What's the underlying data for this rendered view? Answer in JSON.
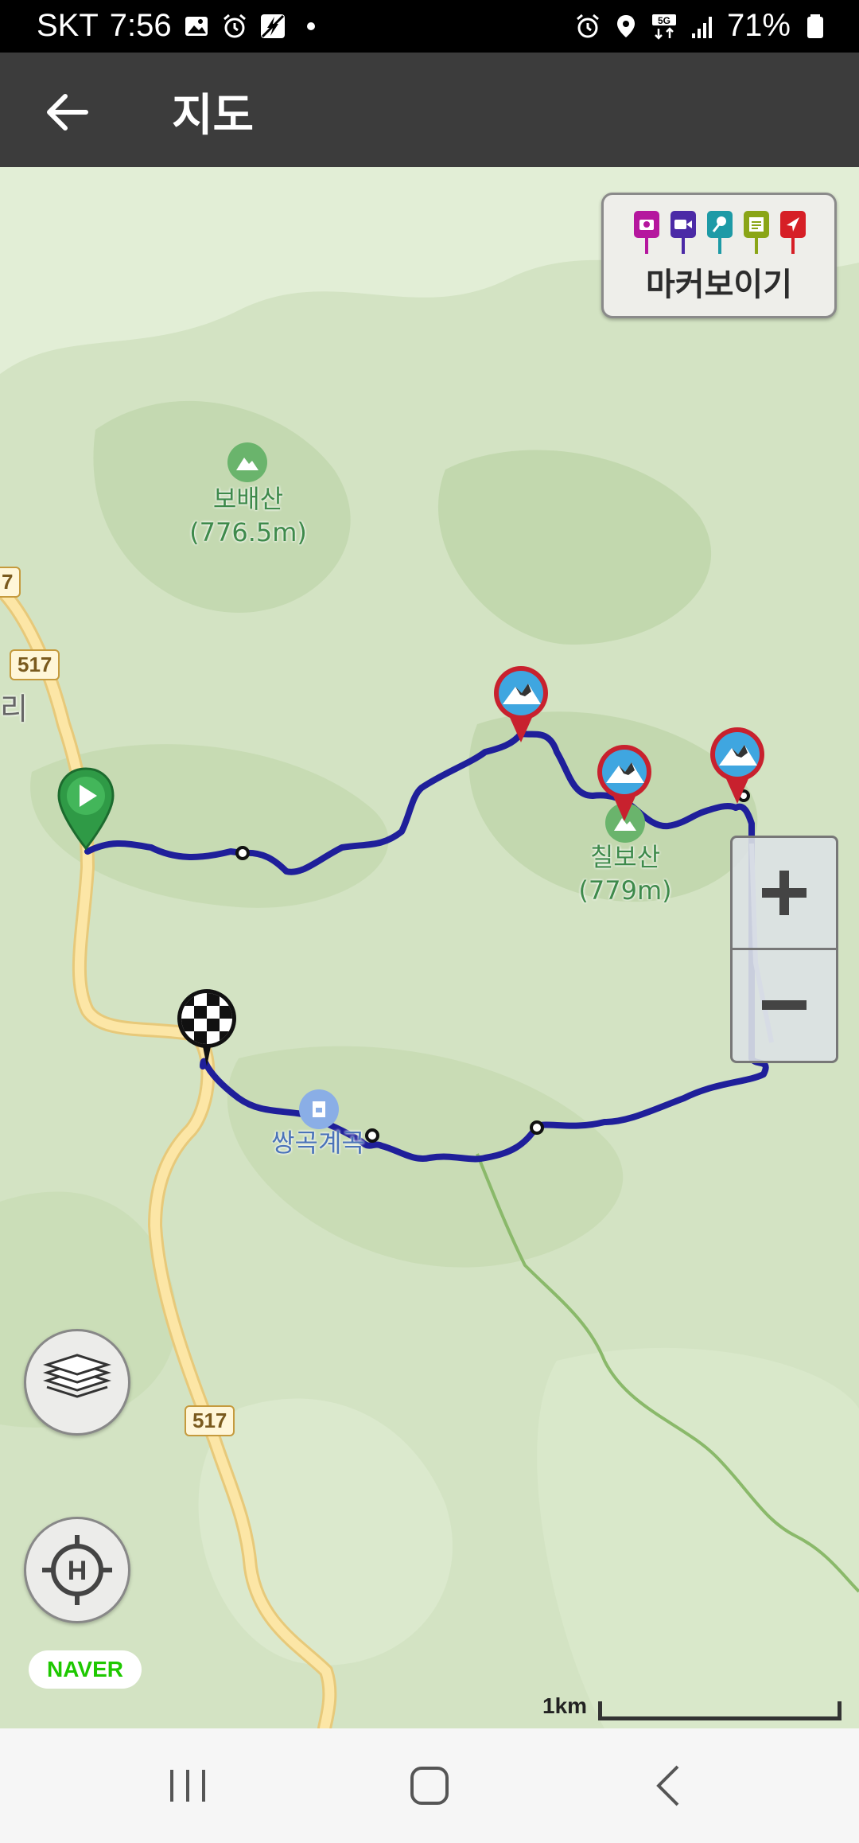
{
  "status_bar": {
    "carrier": "SKT",
    "time": "7:56",
    "battery": "71%",
    "icons_left": [
      "gallery-icon",
      "alarm-icon",
      "no-charging-icon",
      "dot-icon"
    ],
    "icons_right": [
      "alarm-icon",
      "location-icon",
      "5g-icon",
      "signal-icon",
      "battery-icon"
    ]
  },
  "app_bar": {
    "title": "지도"
  },
  "marker_panel": {
    "label": "마커보이기",
    "pin_colors": [
      "#b5179e",
      "#4b2aa6",
      "#1d9aa6",
      "#8aa517",
      "#d61f26"
    ],
    "pin_icons": [
      "camera-icon",
      "video-icon",
      "microphone-icon",
      "memo-icon",
      "navigate-icon"
    ]
  },
  "map": {
    "labels": {
      "mountain1_name": "보배산",
      "mountain1_height": "(776.5m)",
      "mountain2_name": "칠보산",
      "mountain2_height": "(779m)",
      "valley": "쌍곡계곡",
      "village_partial": "리",
      "route_number_edge": "7"
    },
    "road_shields": [
      "517",
      "517"
    ],
    "route_color": "#1f1f9a",
    "road_color": "#fce19a"
  },
  "controls": {
    "zoom_in": "+",
    "zoom_out": "−"
  },
  "attribution": "NAVER",
  "scale": {
    "label": "1km"
  }
}
